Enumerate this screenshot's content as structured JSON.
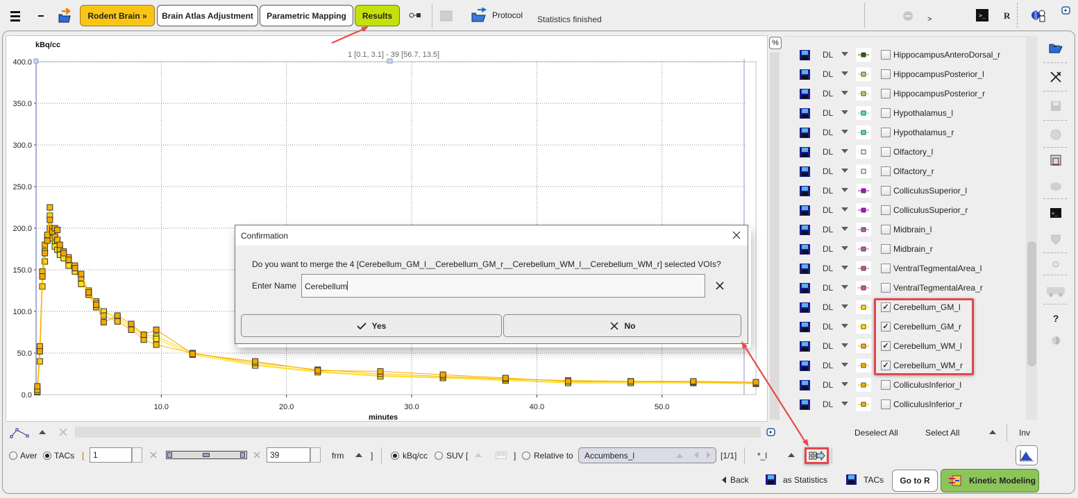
{
  "toolbar": {
    "tabs": [
      {
        "label": "Rodent Brain »",
        "state": "workflow"
      },
      {
        "label": "Brain Atlas Adjustment",
        "state": "normal"
      },
      {
        "label": "Parametric Mapping",
        "state": "normal"
      },
      {
        "label": "Results",
        "state": "active"
      }
    ],
    "protocol_label": "Protocol",
    "status": "Statistics finished",
    "prompt_label": ">",
    "r_label": "R",
    "colors": {
      "workflow": "#f9c514",
      "active": "#c6e00b"
    }
  },
  "chart_data": {
    "type": "line",
    "title": "",
    "ylabel": "kBq/cc",
    "xlabel": "minutes",
    "range_label": "1 [0.1, 3.1] - 39 [56.7, 13.5]",
    "xlim": [
      0,
      57.5
    ],
    "ylim": [
      0,
      400
    ],
    "xticks": [
      "10.0",
      "20.0",
      "30.0",
      "40.0",
      "50.0"
    ],
    "xtick_values": [
      10,
      20,
      30,
      40,
      50
    ],
    "yticks": [
      "0.0",
      "50.0",
      "100.0",
      "150.0",
      "200.0",
      "250.0",
      "300.0",
      "350.0",
      "400.0"
    ],
    "ytick_values": [
      0,
      50,
      100,
      150,
      200,
      250,
      300,
      350,
      400
    ],
    "grid": true,
    "legend": "none",
    "x": [
      0.1,
      0.3,
      0.5,
      0.7,
      0.9,
      1.1,
      1.3,
      1.5,
      1.7,
      1.9,
      2.2,
      2.6,
      3.1,
      3.6,
      4.2,
      4.8,
      5.4,
      6.5,
      7.6,
      8.6,
      9.6,
      12.5,
      17.5,
      22.5,
      27.5,
      32.5,
      37.5,
      42.5,
      47.5,
      52.5,
      57.5
    ],
    "series": [
      {
        "name": "Cerebellum_GM_l",
        "color": "#ffd60a",
        "values": [
          3,
          40,
          130,
          160,
          187,
          200,
          192,
          185,
          180,
          172,
          168,
          160,
          150,
          138,
          125,
          112,
          100,
          93,
          82,
          72,
          70,
          50,
          36,
          28,
          23,
          21,
          18,
          15,
          15,
          15,
          14
        ]
      },
      {
        "name": "Cerebellum_GM_r",
        "color": "#ffe00c",
        "values": [
          4,
          55,
          145,
          172,
          190,
          215,
          188,
          178,
          174,
          168,
          164,
          155,
          148,
          133,
          122,
          110,
          100,
          90,
          80,
          70,
          67,
          48,
          35,
          27,
          22,
          20,
          17,
          14,
          14,
          14,
          13
        ]
      },
      {
        "name": "Cerebellum_WM_l",
        "color": "#f8b800",
        "values": [
          6,
          58,
          148,
          180,
          192,
          225,
          200,
          190,
          186,
          175,
          172,
          165,
          155,
          140,
          120,
          105,
          95,
          88,
          78,
          66,
          60,
          50,
          38,
          30,
          25,
          22,
          19,
          17,
          16,
          15,
          14
        ]
      },
      {
        "name": "Cerebellum_WM_r",
        "color": "#f5a800",
        "values": [
          10,
          52,
          142,
          170,
          185,
          210,
          196,
          200,
          198,
          180,
          170,
          162,
          152,
          145,
          123,
          108,
          87,
          95,
          85,
          72,
          78,
          49,
          40,
          29,
          28,
          24,
          20,
          16,
          16,
          16,
          15
        ]
      }
    ]
  },
  "dialog": {
    "title": "Confirmation",
    "message": "Do you want to merge the 4 [Cerebellum_GM_l__Cerebellum_GM_r__Cerebellum_WM_l__Cerebellum_WM_r] selected VOIs?",
    "name_label": "Enter Name",
    "name_value": "Cerebellum",
    "yes_label": "Yes",
    "no_label": "No"
  },
  "voi_list": {
    "items": [
      {
        "mode": "DL",
        "name": "HippocampusAnteroDorsal_r",
        "color": "#2e5e1a",
        "checked": false
      },
      {
        "mode": "DL",
        "name": "HippocampusPosterior_l",
        "color": "#a8d47a",
        "checked": false
      },
      {
        "mode": "DL",
        "name": "HippocampusPosterior_r",
        "color": "#a8d47a",
        "checked": false
      },
      {
        "mode": "DL",
        "name": "Hypothalamus_l",
        "color": "#5fe0a0",
        "checked": false
      },
      {
        "mode": "DL",
        "name": "Hypothalamus_r",
        "color": "#5fe0a0",
        "checked": false
      },
      {
        "mode": "DL",
        "name": "Olfactory_l",
        "color": "#f4f4e0",
        "checked": false
      },
      {
        "mode": "DL",
        "name": "Olfactory_r",
        "color": "#f4f4e0",
        "checked": false
      },
      {
        "mode": "DL",
        "name": "ColliculusSuperior_l",
        "color": "#b012c8",
        "checked": false
      },
      {
        "mode": "DL",
        "name": "ColliculusSuperior_r",
        "color": "#b012c8",
        "checked": false
      },
      {
        "mode": "DL",
        "name": "Midbrain_l",
        "color": "#b060b0",
        "checked": false
      },
      {
        "mode": "DL",
        "name": "Midbrain_r",
        "color": "#b060b0",
        "checked": false
      },
      {
        "mode": "DL",
        "name": "VentralTegmentalArea_l",
        "color": "#d050a0",
        "checked": false
      },
      {
        "mode": "DL",
        "name": "VentralTegmentalArea_r",
        "color": "#d050a0",
        "checked": false
      },
      {
        "mode": "DL",
        "name": "Cerebellum_GM_l",
        "color": "#ffe000",
        "checked": true
      },
      {
        "mode": "DL",
        "name": "Cerebellum_GM_r",
        "color": "#ffe000",
        "checked": true
      },
      {
        "mode": "DL",
        "name": "Cerebellum_WM_l",
        "color": "#f8b000",
        "checked": true
      },
      {
        "mode": "DL",
        "name": "Cerebellum_WM_r",
        "color": "#f8b000",
        "checked": true
      },
      {
        "mode": "DL",
        "name": "ColliculusInferior_l",
        "color": "#f8b000",
        "checked": false
      },
      {
        "mode": "DL",
        "name": "ColliculusInferior_r",
        "color": "#f8b000",
        "checked": false
      }
    ],
    "deselect_all": "Deselect All",
    "select_all": "Select All",
    "inv": "Inv"
  },
  "controls": {
    "percent_label": "%",
    "aver_label": "Aver",
    "tacs_label": "TACs",
    "bracket_open": "[",
    "bracket_close": "]",
    "frame_start": "1",
    "frame_end": "39",
    "frm_label": "frm",
    "kbq_label": "kBq/cc",
    "suv_label": "SUV [",
    "suv_close": "]",
    "relative_label": "Relative to",
    "relative_value": "Accumbens_l",
    "relative_count": "[1/1]",
    "filter_label": "*_l",
    "selected_unit": "kBq/cc",
    "selected_mode": "TACs"
  },
  "footer": {
    "back_label": "Back",
    "as_statistics_label": "as Statistics",
    "tacs_label": "TACs",
    "go_to_r_label": "Go to R",
    "kinetic_modeling_label": "Kinetic Modeling",
    "kinetic_color": "#8cc45a"
  }
}
